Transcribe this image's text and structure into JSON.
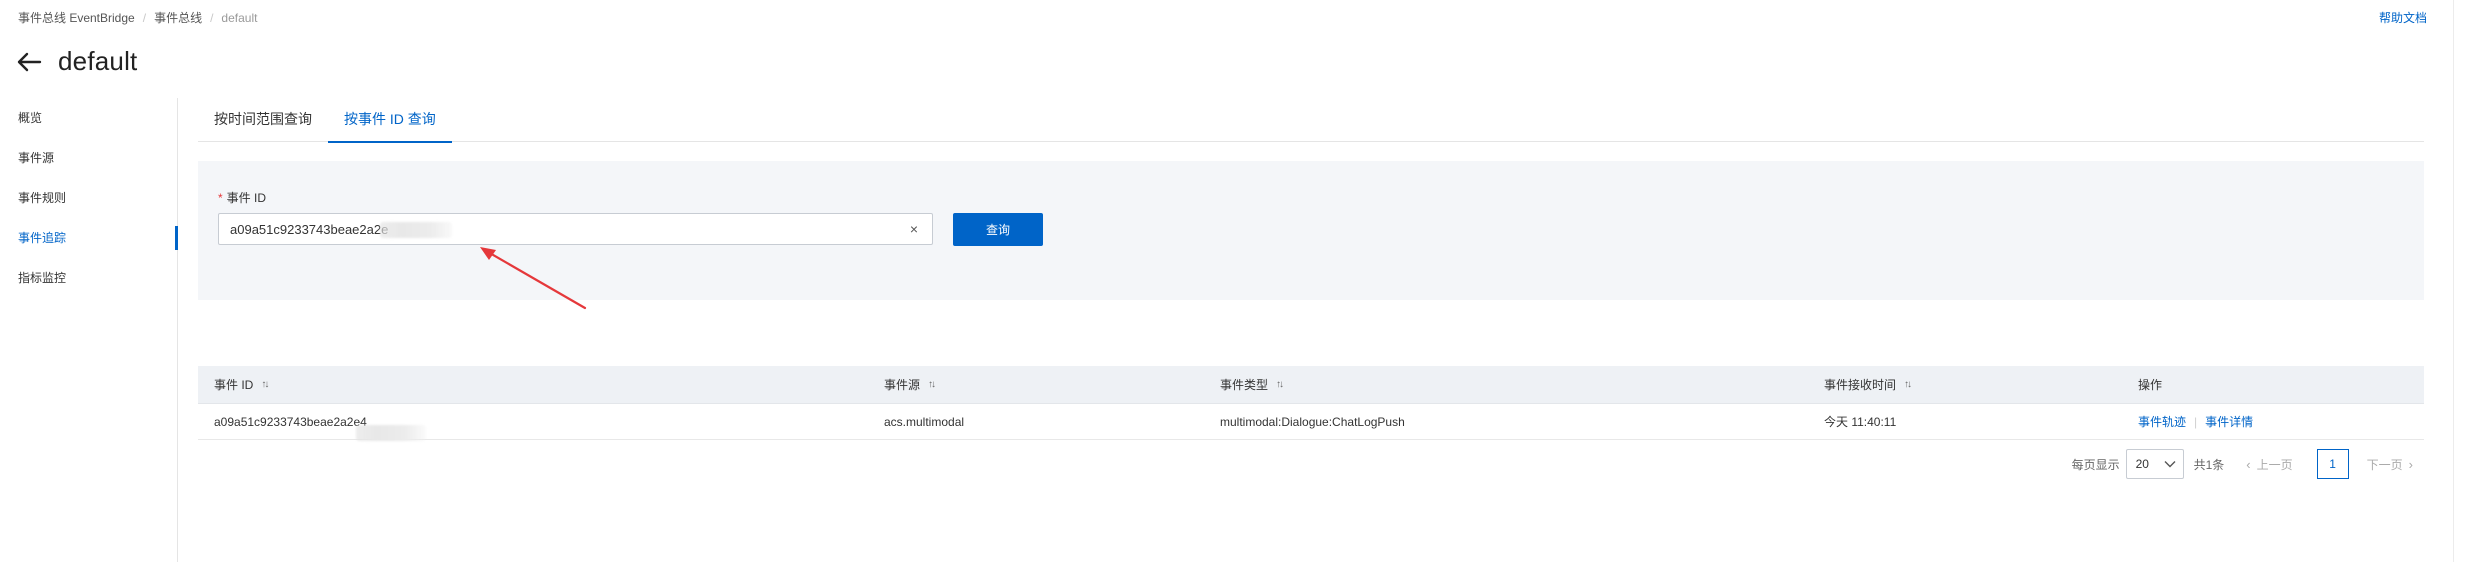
{
  "breadcrumb": {
    "items": [
      "事件总线 EventBridge",
      "事件总线",
      "default"
    ]
  },
  "header": {
    "help_label": "帮助文档",
    "title": "default"
  },
  "sidebar": {
    "items": [
      {
        "label": "概览"
      },
      {
        "label": "事件源"
      },
      {
        "label": "事件规则"
      },
      {
        "label": "事件追踪",
        "active": true
      },
      {
        "label": "指标监控"
      }
    ]
  },
  "tabs": [
    {
      "label": "按时间范围查询"
    },
    {
      "label": "按事件 ID 查询",
      "active": true
    }
  ],
  "query": {
    "required_mark": "*",
    "field_label": "事件 ID",
    "input_value": "a09a51c9233743beae2a2e",
    "clear_glyph": "×",
    "button_label": "查询"
  },
  "table": {
    "columns": [
      {
        "label": "事件 ID",
        "sortable": true
      },
      {
        "label": "事件源",
        "sortable": true
      },
      {
        "label": "事件类型",
        "sortable": true
      },
      {
        "label": "事件接收时间",
        "sortable": true
      },
      {
        "label": "操作",
        "sortable": false
      }
    ],
    "rows": [
      {
        "event_id": "a09a51c9233743beae2a2e4",
        "source": "acs.multimodal",
        "type": "multimodal:Dialogue:ChatLogPush",
        "time": "今天 11:40:11",
        "actions": [
          "事件轨迹",
          "事件详情"
        ]
      }
    ]
  },
  "pagination": {
    "page_size_label": "每页显示",
    "page_size": "20",
    "total": "共1条",
    "prev": "上一页",
    "current_page": "1",
    "next": "下一页"
  },
  "colors": {
    "accent": "#0064c8",
    "panel_bg": "#f4f6f9",
    "arrow": "#e5383b"
  },
  "icons": {
    "back": "arrow-left-icon",
    "sort": "sort-icon",
    "clear": "close-icon",
    "dropdown": "chevron-down-icon"
  }
}
